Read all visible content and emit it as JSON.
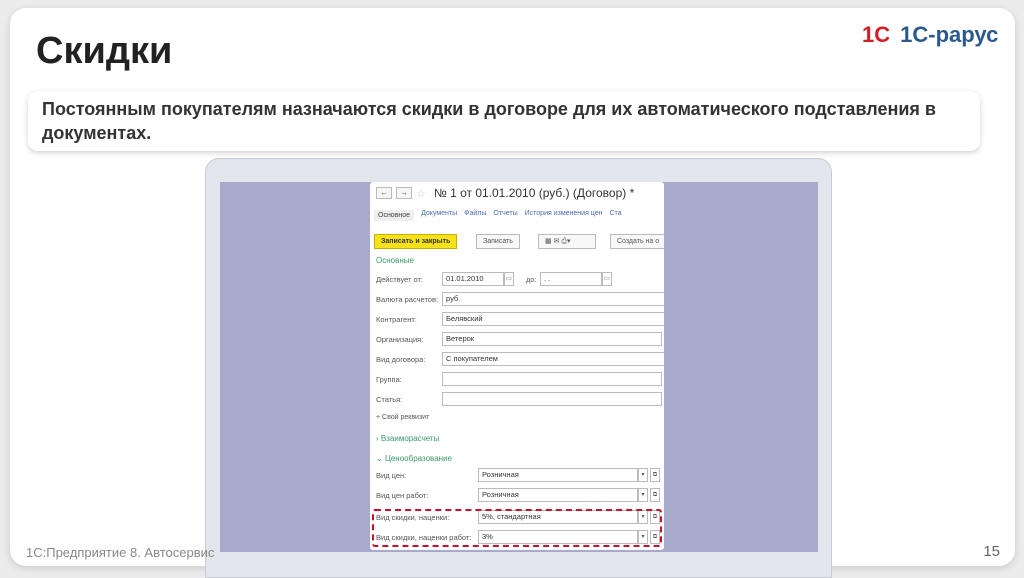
{
  "slide": {
    "title": "Скидки",
    "subtitle": "Постоянным покупателям назначаются скидки в договоре для их автоматического подставления в документах.",
    "footer": "1С:Предприятие 8. Автосервис",
    "page_number": "15",
    "logo": [
      "1С",
      "1С-рарус"
    ]
  },
  "form": {
    "back": "←",
    "forward": "→",
    "star": "☆",
    "title": "№ 1 от 01.01.2010 (руб.) (Договор) *",
    "tabs": [
      "Основное",
      "Документы",
      "Файлы",
      "Отчеты",
      "История изменения цен",
      "Ста"
    ],
    "buttons": {
      "save_close": "Записать и закрыть",
      "save": "Записать",
      "create": "Создать на о"
    },
    "section_main": "Основные",
    "valid_from_label": "Действует от:",
    "valid_from": "01.01.2010",
    "to_label": "до:",
    "to_value": ". .",
    "currency_label": "Валюта расчетов:",
    "currency": "руб.",
    "counterparty_label": "Контрагент:",
    "counterparty": "Белявский",
    "org_label": "Организация:",
    "org": "Ветерок",
    "type_label": "Вид договора:",
    "type": "С покупателем",
    "group_label": "Группа:",
    "group": "",
    "article_label": "Статья:",
    "article": "",
    "custom_attr": "+ Свой реквизит",
    "settlements": "Взаиморасчеты",
    "pricing": "Ценообразование",
    "price_type_label": "Вид цен:",
    "price_type": "Розничная",
    "work_price_label": "Вид цен работ:",
    "work_price": "Розничная",
    "discount_label": "Вид скидки, наценки:",
    "discount": "5%, стандартная",
    "work_discount_label": "Вид скидки, наценки работ:",
    "work_discount": "3%"
  }
}
